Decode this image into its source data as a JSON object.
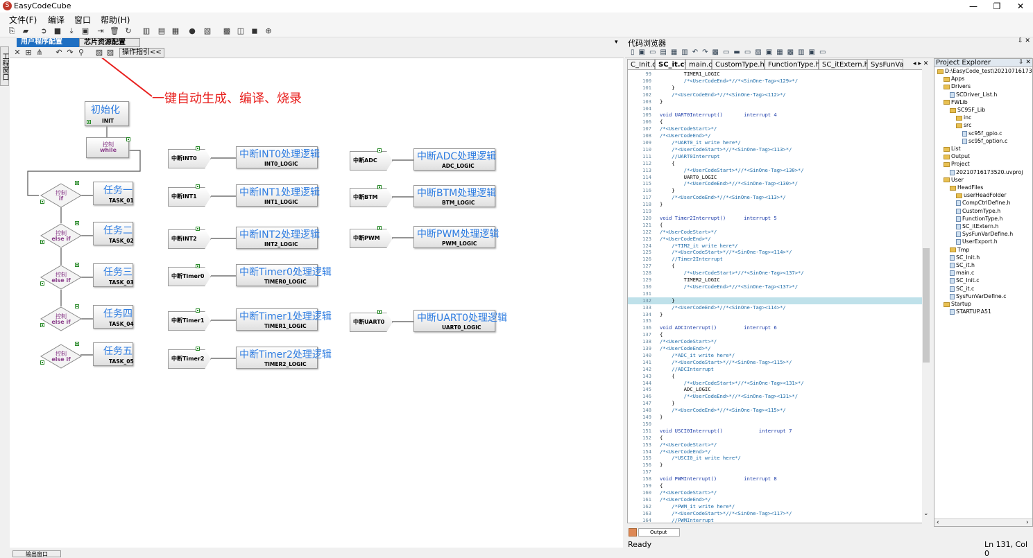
{
  "window": {
    "title": "EasyCodeCube",
    "minimize": "—",
    "restore": "❐",
    "close": "✕"
  },
  "menu": [
    {
      "label": "文件(F)"
    },
    {
      "label": "编译"
    },
    {
      "label": "窗口"
    },
    {
      "label": "帮助(H)"
    }
  ],
  "toolbar_icons": [
    "new-icon",
    "open-icon",
    "run-icon",
    "stop-icon",
    "download-icon",
    "build-icon",
    "export-icon",
    "delete-icon",
    "refresh-icon",
    "map-icon",
    "chip-icon",
    "screen-icon",
    "dot-icon",
    "doc-icon",
    "grid-icon",
    "window-icon",
    "chat-icon",
    "globe-icon"
  ],
  "left_vertical_tab": "工程窗口",
  "design_tabs": [
    {
      "label": "用户程序配置",
      "active": true
    },
    {
      "label": "芯片资源配置",
      "active": false
    }
  ],
  "design_toolbar": {
    "guide_button": "操作指引<<"
  },
  "annotation": {
    "text": "一键自动生成、编译、烧录",
    "color": "#e8211f"
  },
  "flow": {
    "init": {
      "title": "初始化",
      "sub": "INIT"
    },
    "while": {
      "top": "控制",
      "bot": "while"
    },
    "tasks": [
      {
        "top": "控制",
        "bot": "if",
        "title": "任务一",
        "sub": "TASK_01"
      },
      {
        "top": "控制",
        "bot": "else if",
        "title": "任务二",
        "sub": "TASK_02"
      },
      {
        "top": "控制",
        "bot": "else if",
        "title": "任务三",
        "sub": "TASK_03"
      },
      {
        "top": "控制",
        "bot": "else if",
        "title": "任务四",
        "sub": "TASK_04"
      },
      {
        "top": "控制",
        "bot": "else if",
        "title": "任务五",
        "sub": "TASK_05"
      }
    ],
    "interrupts_col1": [
      {
        "label": "中断INT0",
        "title": "中断INT0处理逻辑",
        "sub": "INT0_LOGIC"
      },
      {
        "label": "中断INT1",
        "title": "中断INT1处理逻辑",
        "sub": "INT1_LOGIC"
      },
      {
        "label": "中断INT2",
        "title": "中断INT2处理逻辑",
        "sub": "INT2_LOGIC"
      },
      {
        "label": "中断Timer0",
        "title": "中断Timer0处理逻辑",
        "sub": "TIMER0_LOGIC"
      },
      {
        "label": "中断Timer1",
        "title": "中断Timer1处理逻辑",
        "sub": "TIMER1_LOGIC"
      },
      {
        "label": "中断Timer2",
        "title": "中断Timer2处理逻辑",
        "sub": "TIMER2_LOGIC"
      }
    ],
    "interrupts_col2": [
      {
        "label": "中断ADC",
        "title": "中断ADC处理逻辑",
        "sub": "ADC_LOGIC"
      },
      {
        "label": "中断BTM",
        "title": "中断BTM处理逻辑",
        "sub": "BTM_LOGIC"
      },
      {
        "label": "中断PWM",
        "title": "中断PWM处理逻辑",
        "sub": "PWM_LOGIC"
      },
      {
        "label": "中断UART0",
        "title": "中断UART0处理逻辑",
        "sub": "UART0_LOGIC"
      }
    ]
  },
  "code_browser": {
    "title": "代码浏览器",
    "pin": "⇩ ✕",
    "file_tabs": [
      "C_Init.c",
      "SC_it.c*",
      "main.c",
      "CustomType.h",
      "FunctionType.h",
      "SC_itExtern.h",
      "SysFunVa"
    ],
    "active_tab": "SC_it.c*",
    "lines": [
      {
        "n": "99",
        "t": "        TIMER1_LOGIC",
        "c": ""
      },
      {
        "n": "100",
        "t": "        /*<UserCodeEnd>*//*<SinOne-Tag><129>*/",
        "c": "cm"
      },
      {
        "n": "101",
        "t": "    }",
        "c": ""
      },
      {
        "n": "102",
        "t": "    /*<UserCodeEnd>*//*<SinOne-Tag><112>*/",
        "c": "cm"
      },
      {
        "n": "103",
        "t": "}",
        "c": ""
      },
      {
        "n": "104",
        "t": "",
        "c": ""
      },
      {
        "n": "105",
        "t": "void UART0Interrupt()       interrupt 4",
        "c": "kw"
      },
      {
        "n": "106",
        "t": "{",
        "c": ""
      },
      {
        "n": "107",
        "t": "/*<UserCodeStart>*/",
        "c": "cm"
      },
      {
        "n": "108",
        "t": "/*<UserCodeEnd>*/",
        "c": "cm"
      },
      {
        "n": "109",
        "t": "    /*UART0_it write here*/",
        "c": "cm"
      },
      {
        "n": "110",
        "t": "    /*<UserCodeStart>*//*<SinOne-Tag><113>*/",
        "c": "cm"
      },
      {
        "n": "111",
        "t": "    //UART0Interrupt",
        "c": "cm"
      },
      {
        "n": "112",
        "t": "    {",
        "c": ""
      },
      {
        "n": "113",
        "t": "        /*<UserCodeStart>*//*<SinOne-Tag><130>*/",
        "c": "cm"
      },
      {
        "n": "114",
        "t": "        UART0_LOGIC",
        "c": ""
      },
      {
        "n": "115",
        "t": "        /*<UserCodeEnd>*//*<SinOne-Tag><130>*/",
        "c": "cm"
      },
      {
        "n": "116",
        "t": "    }",
        "c": ""
      },
      {
        "n": "117",
        "t": "    /*<UserCodeEnd>*//*<SinOne-Tag><113>*/",
        "c": "cm"
      },
      {
        "n": "118",
        "t": "}",
        "c": ""
      },
      {
        "n": "119",
        "t": "",
        "c": ""
      },
      {
        "n": "120",
        "t": "void Timer2Interrupt()      interrupt 5",
        "c": "kw"
      },
      {
        "n": "121",
        "t": "{",
        "c": ""
      },
      {
        "n": "122",
        "t": "/*<UserCodeStart>*/",
        "c": "cm"
      },
      {
        "n": "123",
        "t": "/*<UserCodeEnd>*/",
        "c": "cm"
      },
      {
        "n": "124",
        "t": "    /*TIM2_it write here*/",
        "c": "cm"
      },
      {
        "n": "125",
        "t": "    /*<UserCodeStart>*//*<SinOne-Tag><114>*/",
        "c": "cm"
      },
      {
        "n": "126",
        "t": "    //Timer2Interrupt",
        "c": "cm"
      },
      {
        "n": "127",
        "t": "    {",
        "c": ""
      },
      {
        "n": "128",
        "t": "        /*<UserCodeStart>*//*<SinOne-Tag><137>*/",
        "c": "cm"
      },
      {
        "n": "129",
        "t": "        TIMER2_LOGIC",
        "c": ""
      },
      {
        "n": "130",
        "t": "        /*<UserCodeEnd>*//*<SinOne-Tag><137>*/",
        "c": "cm"
      },
      {
        "n": "131",
        "t": "",
        "c": ""
      },
      {
        "n": "132",
        "t": "    }",
        "c": "hl"
      },
      {
        "n": "133",
        "t": "    /*<UserCodeEnd>*//*<SinOne-Tag><114>*/",
        "c": "cm"
      },
      {
        "n": "134",
        "t": "}",
        "c": ""
      },
      {
        "n": "135",
        "t": "",
        "c": ""
      },
      {
        "n": "136",
        "t": "void ADCInterrupt()         interrupt 6",
        "c": "kw"
      },
      {
        "n": "137",
        "t": "{",
        "c": ""
      },
      {
        "n": "138",
        "t": "/*<UserCodeStart>*/",
        "c": "cm"
      },
      {
        "n": "139",
        "t": "/*<UserCodeEnd>*/",
        "c": "cm"
      },
      {
        "n": "140",
        "t": "    /*ADC_it write here*/",
        "c": "cm"
      },
      {
        "n": "141",
        "t": "    /*<UserCodeStart>*//*<SinOne-Tag><115>*/",
        "c": "cm"
      },
      {
        "n": "142",
        "t": "    //ADCInterrupt",
        "c": "cm"
      },
      {
        "n": "143",
        "t": "    {",
        "c": ""
      },
      {
        "n": "144",
        "t": "        /*<UserCodeStart>*//*<SinOne-Tag><131>*/",
        "c": "cm"
      },
      {
        "n": "145",
        "t": "        ADC_LOGIC",
        "c": ""
      },
      {
        "n": "146",
        "t": "        /*<UserCodeEnd>*//*<SinOne-Tag><131>*/",
        "c": "cm"
      },
      {
        "n": "147",
        "t": "    }",
        "c": ""
      },
      {
        "n": "148",
        "t": "    /*<UserCodeEnd>*//*<SinOne-Tag><115>*/",
        "c": "cm"
      },
      {
        "n": "149",
        "t": "}",
        "c": ""
      },
      {
        "n": "150",
        "t": "",
        "c": ""
      },
      {
        "n": "151",
        "t": "void USCI0Interrupt()            interrupt 7",
        "c": "kw"
      },
      {
        "n": "152",
        "t": "{",
        "c": ""
      },
      {
        "n": "153",
        "t": "/*<UserCodeStart>*/",
        "c": "cm"
      },
      {
        "n": "154",
        "t": "/*<UserCodeEnd>*/",
        "c": "cm"
      },
      {
        "n": "155",
        "t": "    /*USCI0_it write here*/",
        "c": "cm"
      },
      {
        "n": "156",
        "t": "}",
        "c": ""
      },
      {
        "n": "157",
        "t": "",
        "c": ""
      },
      {
        "n": "158",
        "t": "void PWMInterrupt()         interrupt 8",
        "c": "kw"
      },
      {
        "n": "159",
        "t": "{",
        "c": ""
      },
      {
        "n": "160",
        "t": "/*<UserCodeStart>*/",
        "c": "cm"
      },
      {
        "n": "161",
        "t": "/*<UserCodeEnd>*/",
        "c": "cm"
      },
      {
        "n": "162",
        "t": "    /*PWM_it write here*/",
        "c": "cm"
      },
      {
        "n": "163",
        "t": "    /*<UserCodeStart>*//*<SinOne-Tag><117>*/",
        "c": "cm"
      },
      {
        "n": "164",
        "t": "    //PWMInterrupt",
        "c": "cm"
      }
    ]
  },
  "project_explorer": {
    "title": "Project Explorer",
    "pin": "⇩ ✕",
    "items": [
      {
        "label": "D:\\EasyCode_test\\20210716173520",
        "depth": 0,
        "kind": "folder"
      },
      {
        "label": "Apps",
        "depth": 1,
        "kind": "folder"
      },
      {
        "label": "Drivers",
        "depth": 1,
        "kind": "folder"
      },
      {
        "label": "SCDriver_List.h",
        "depth": 2,
        "kind": "file"
      },
      {
        "label": "FWLib",
        "depth": 1,
        "kind": "folder"
      },
      {
        "label": "SC95F_Lib",
        "depth": 2,
        "kind": "folder"
      },
      {
        "label": "inc",
        "depth": 3,
        "kind": "folder"
      },
      {
        "label": "src",
        "depth": 3,
        "kind": "folder"
      },
      {
        "label": "sc95f_gpio.c",
        "depth": 4,
        "kind": "file"
      },
      {
        "label": "sc95f_option.c",
        "depth": 4,
        "kind": "file"
      },
      {
        "label": "List",
        "depth": 1,
        "kind": "folder"
      },
      {
        "label": "Output",
        "depth": 1,
        "kind": "folder"
      },
      {
        "label": "Project",
        "depth": 1,
        "kind": "folder"
      },
      {
        "label": "20210716173520.uvproj",
        "depth": 2,
        "kind": "file"
      },
      {
        "label": "User",
        "depth": 1,
        "kind": "folder"
      },
      {
        "label": "HeadFiles",
        "depth": 2,
        "kind": "folder"
      },
      {
        "label": "userHeadFolder",
        "depth": 3,
        "kind": "folder"
      },
      {
        "label": "CompCtrlDefine.h",
        "depth": 3,
        "kind": "file"
      },
      {
        "label": "CustomType.h",
        "depth": 3,
        "kind": "file"
      },
      {
        "label": "FunctionType.h",
        "depth": 3,
        "kind": "file"
      },
      {
        "label": "SC_itExtern.h",
        "depth": 3,
        "kind": "file"
      },
      {
        "label": "SysFunVarDefine.h",
        "depth": 3,
        "kind": "file"
      },
      {
        "label": "UserExport.h",
        "depth": 3,
        "kind": "file"
      },
      {
        "label": "Tmp",
        "depth": 2,
        "kind": "folder"
      },
      {
        "label": "SC_Init.h",
        "depth": 2,
        "kind": "file"
      },
      {
        "label": "SC_it.h",
        "depth": 2,
        "kind": "file"
      },
      {
        "label": "main.c",
        "depth": 2,
        "kind": "file"
      },
      {
        "label": "SC_Init.c",
        "depth": 2,
        "kind": "file"
      },
      {
        "label": "SC_it.c",
        "depth": 2,
        "kind": "file"
      },
      {
        "label": "SysFunVarDefine.c",
        "depth": 2,
        "kind": "file"
      },
      {
        "label": "Startup",
        "depth": 1,
        "kind": "folder"
      },
      {
        "label": "STARTUP.A51",
        "depth": 2,
        "kind": "file"
      }
    ]
  },
  "output_tab": "Output",
  "status": {
    "left": "Ready",
    "right": "Ln 131, Col 0"
  },
  "bottom_tab": "输出窗口"
}
